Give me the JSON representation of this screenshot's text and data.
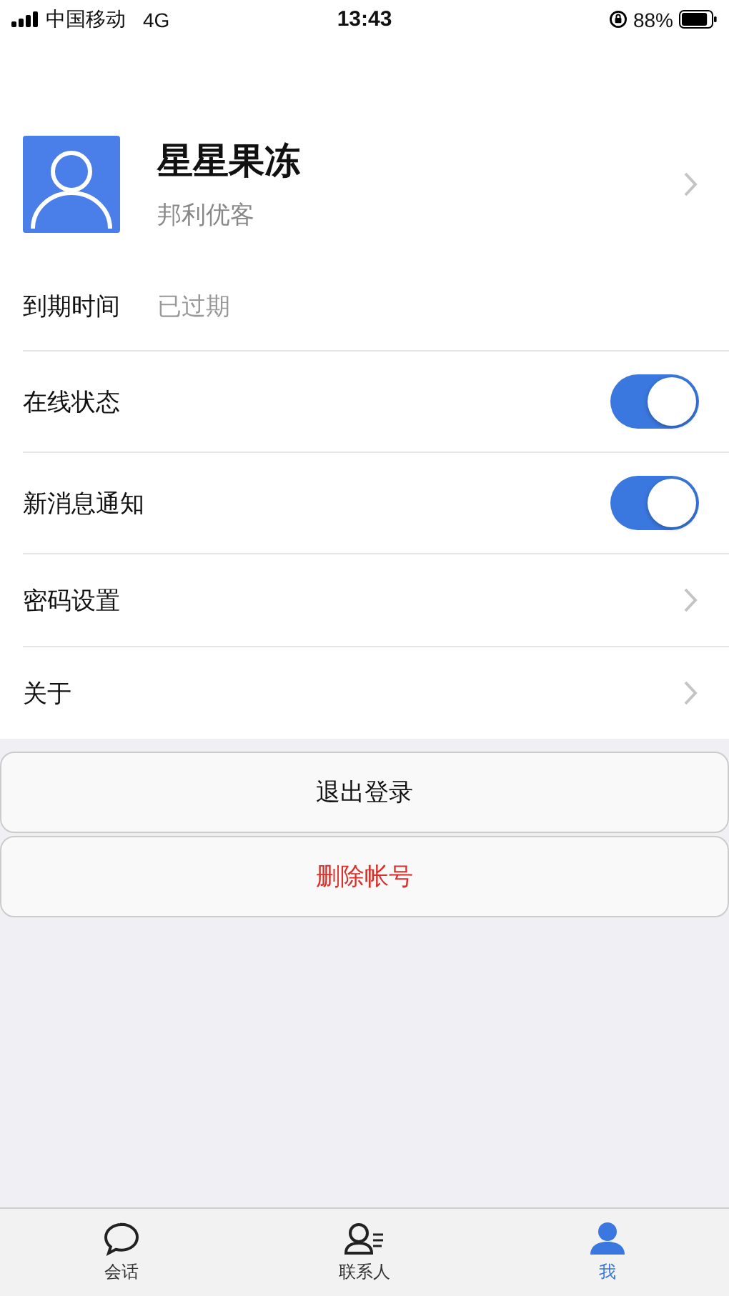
{
  "status_bar": {
    "carrier": "中国移动",
    "network": "4G",
    "time": "13:43",
    "battery": "88%"
  },
  "profile": {
    "name": "星星果冻",
    "subtitle": "邦利优客"
  },
  "settings": [
    {
      "kind": "info",
      "label": "到期时间",
      "value": "已过期"
    },
    {
      "kind": "toggle",
      "label": "在线状态",
      "on": true
    },
    {
      "kind": "toggle",
      "label": "新消息通知",
      "on": true
    },
    {
      "kind": "link",
      "label": "密码设置"
    },
    {
      "kind": "link",
      "label": "关于"
    }
  ],
  "buttons": [
    {
      "label": "退出登录",
      "kind": "normal"
    },
    {
      "label": "删除帐号",
      "kind": "danger"
    }
  ],
  "tabs": [
    {
      "label": "会话",
      "kind": "chat",
      "selected": false
    },
    {
      "label": "联系人",
      "kind": "contacts",
      "selected": false
    },
    {
      "label": "我",
      "kind": "me",
      "selected": true
    }
  ]
}
